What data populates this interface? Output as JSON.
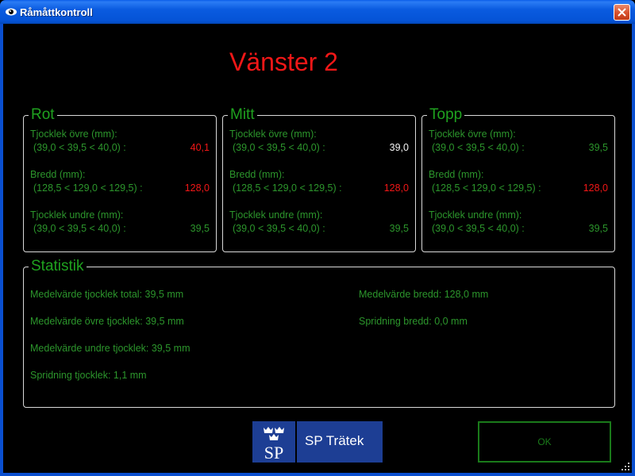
{
  "window": {
    "title": "Råmåttkontroll"
  },
  "heading": "Vänster 2",
  "colors": {
    "accent_green": "#1fa21f",
    "text_green": "#2c962c",
    "alert_red": "#f21717",
    "title_blue": "#0553d6"
  },
  "sections": [
    {
      "legend": "Rot",
      "rows": [
        {
          "label": "Tjocklek övre (mm):",
          "range": "(39,0 < 39,5 < 40,0) :",
          "value": "40,1",
          "status": "red"
        },
        {
          "label": "Bredd (mm):",
          "range": "(128,5 < 129,0 < 129,5) :",
          "value": "128,0",
          "status": "red"
        },
        {
          "label": "Tjocklek undre (mm):",
          "range": "(39,0 < 39,5 < 40,0) :",
          "value": "39,5",
          "status": "green"
        }
      ]
    },
    {
      "legend": "Mitt",
      "rows": [
        {
          "label": "Tjocklek övre (mm):",
          "range": "(39,0 < 39,5 < 40,0) :",
          "value": "39,0",
          "status": "white"
        },
        {
          "label": "Bredd (mm):",
          "range": "(128,5 < 129,0 < 129,5) :",
          "value": "128,0",
          "status": "red"
        },
        {
          "label": "Tjocklek undre (mm):",
          "range": "(39,0 < 39,5 < 40,0) :",
          "value": "39,5",
          "status": "green"
        }
      ]
    },
    {
      "legend": "Topp",
      "rows": [
        {
          "label": "Tjocklek övre (mm):",
          "range": "(39,0 < 39,5 < 40,0) :",
          "value": "39,5",
          "status": "green"
        },
        {
          "label": "Bredd (mm):",
          "range": "(128,5 < 129,0 < 129,5) :",
          "value": "128,0",
          "status": "red"
        },
        {
          "label": "Tjocklek undre (mm):",
          "range": "(39,0 < 39,5 < 40,0) :",
          "value": "39,5",
          "status": "green"
        }
      ]
    }
  ],
  "statistics": {
    "legend": "Statistik",
    "left": [
      "Medelvärde tjocklek total: 39,5 mm",
      "Medelvärde övre tjocklek: 39,5 mm",
      "Medelvärde undre tjocklek: 39,5 mm",
      "Spridning tjocklek: 1,1 mm"
    ],
    "right": [
      "Medelvärde bredd: 128,0 mm",
      "Spridning bredd: 0,0 mm"
    ]
  },
  "logo": {
    "crest_text": "SP",
    "name": "SP Trätek"
  },
  "ok_label": "OK",
  "icons": {
    "app": "eye-icon",
    "close": "close-icon",
    "grip": "resize-grip-icon"
  }
}
